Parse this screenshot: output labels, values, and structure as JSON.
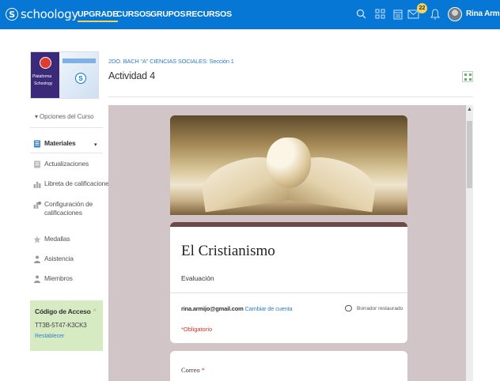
{
  "topbar": {
    "logo_text": "schoology",
    "logo_glyph": "S",
    "nav": [
      "UPGRADE",
      "CURSOS",
      "GRUPOS",
      "RECURSOS"
    ],
    "notification_count": "22",
    "user_name": "Rina Armijo",
    "icons": [
      "search-icon",
      "apps-grid-icon",
      "calendar-icon",
      "messages-icon",
      "bell-icon",
      "chevron-down-icon"
    ],
    "color": "#0677d4"
  },
  "sidebar": {
    "course_image_texts": [
      "Plataforma",
      "Schoology"
    ],
    "options_label": "Opciones del Curso",
    "items": [
      {
        "label": "Materiales",
        "icon": "materials-icon"
      },
      {
        "label": "Actualizaciones",
        "icon": "updates-icon"
      },
      {
        "label": "Libreta de calificaciones",
        "icon": "gradebook-icon"
      },
      {
        "label": "Configuración de calificaciones",
        "icon": "grade-settings-icon"
      },
      {
        "label": "Medallas",
        "icon": "badge-icon"
      },
      {
        "label": "Asistencia",
        "icon": "attendance-icon"
      },
      {
        "label": "Miembros",
        "icon": "members-icon"
      }
    ],
    "access": {
      "title": "Código de Acceso",
      "code": "TT3B-5T47-K3CK3",
      "reset": "Restablecer",
      "close": "×",
      "color": "#d7ebc3"
    }
  },
  "main": {
    "breadcrumb": "2DO. BACH \"A\" CIENCIAS SOCIALES: Sección 1",
    "title": "Actividad 4"
  },
  "form": {
    "title": "El Cristianismo",
    "description": "Evaluación",
    "email": "rina.armijo@gmail.com",
    "switch_account": "Cambiar de cuenta",
    "draft_status": "Borrador restaurado",
    "required_note": "*Obligatorio",
    "field_label": "Correo",
    "field_required": "*",
    "accent_color": "#6d4a47",
    "background_color": "#d2c5c7"
  }
}
